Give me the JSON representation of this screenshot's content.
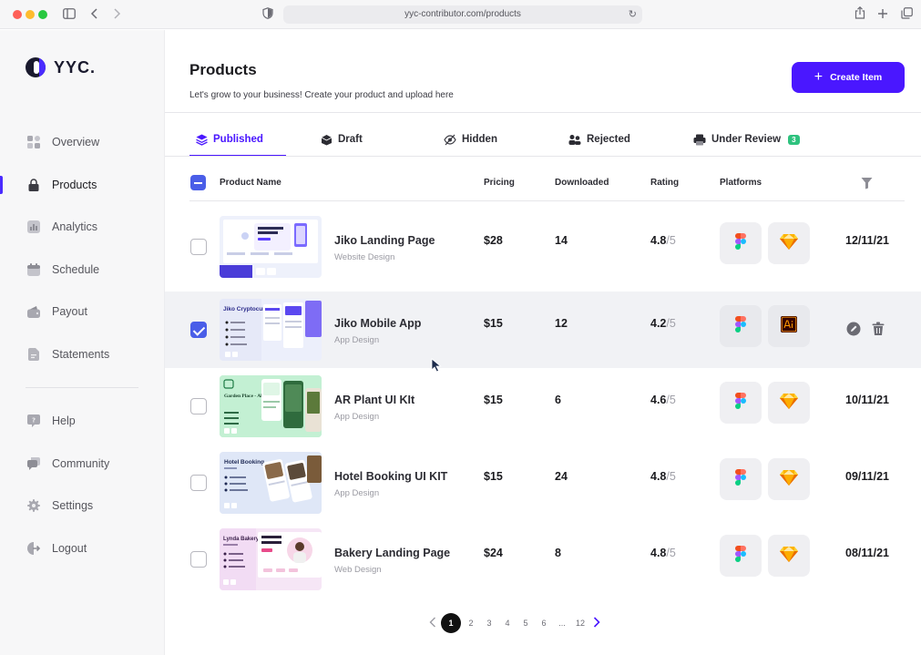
{
  "browser": {
    "url": "yyc-contributor.com/products"
  },
  "brand": {
    "name": "YYC.",
    "accent": "#4a17ff"
  },
  "sidebar": {
    "items": [
      {
        "label": "Overview",
        "icon": "grid-icon"
      },
      {
        "label": "Products",
        "icon": "lock-bag-icon",
        "active": true
      },
      {
        "label": "Analytics",
        "icon": "chart-icon"
      },
      {
        "label": "Schedule",
        "icon": "calendar-icon"
      },
      {
        "label": "Payout",
        "icon": "wallet-icon"
      },
      {
        "label": "Statements",
        "icon": "document-icon"
      }
    ],
    "secondary": [
      {
        "label": "Help",
        "icon": "help-icon"
      },
      {
        "label": "Community",
        "icon": "chat-icon"
      },
      {
        "label": "Settings",
        "icon": "gear-icon"
      },
      {
        "label": "Logout",
        "icon": "logout-icon"
      }
    ]
  },
  "header": {
    "title": "Products",
    "subtitle": "Let's grow to your business! Create your product and upload here",
    "create_label": "Create Item"
  },
  "tabs": [
    {
      "label": "Published",
      "active": true
    },
    {
      "label": "Draft"
    },
    {
      "label": "Hidden"
    },
    {
      "label": "Rejected"
    },
    {
      "label": "Under Review",
      "badge": "3"
    }
  ],
  "table": {
    "columns": [
      "Product Name",
      "Pricing",
      "Downloaded",
      "Rating",
      "Platforms"
    ],
    "rows": [
      {
        "name": "Jiko Landing Page",
        "category": "Website Design",
        "price": "$28",
        "downloads": "14",
        "rating": "4.8",
        "rating_max": "/5",
        "platforms": [
          "figma-icon",
          "sketch-icon"
        ],
        "date": "12/11/21",
        "checked": false
      },
      {
        "name": "Jiko Mobile App",
        "category": "App Design",
        "price": "$15",
        "downloads": "12",
        "rating": "4.2",
        "rating_max": "/5",
        "platforms": [
          "figma-icon",
          "illustrator-icon"
        ],
        "date": "",
        "checked": true
      },
      {
        "name": "AR Plant UI KIt",
        "category": "App Design",
        "price": "$15",
        "downloads": "6",
        "rating": "4.6",
        "rating_max": "/5",
        "platforms": [
          "figma-icon",
          "sketch-icon"
        ],
        "date": "10/11/21",
        "checked": false
      },
      {
        "name": "Hotel Booking UI KIT",
        "category": "App Design",
        "price": "$15",
        "downloads": "24",
        "rating": "4.8",
        "rating_max": "/5",
        "platforms": [
          "figma-icon",
          "sketch-icon"
        ],
        "date": "09/11/21",
        "checked": false
      },
      {
        "name": "Bakery Landing Page",
        "category": "Web Design",
        "price": "$24",
        "downloads": "8",
        "rating": "4.8",
        "rating_max": "/5",
        "platforms": [
          "figma-icon",
          "sketch-icon"
        ],
        "date": "08/11/21",
        "checked": false
      }
    ]
  },
  "thumbs": {
    "jiko_mobile_title": "Jiko Cryptocurrency",
    "plant_title": "Garden Place - All Plant",
    "hotel_title": "Hotel Booking",
    "bakery_title": "Lynda Bakery"
  },
  "pagination": {
    "pages": [
      "1",
      "2",
      "3",
      "4",
      "5",
      "6",
      "...",
      "12"
    ],
    "current": "1"
  }
}
